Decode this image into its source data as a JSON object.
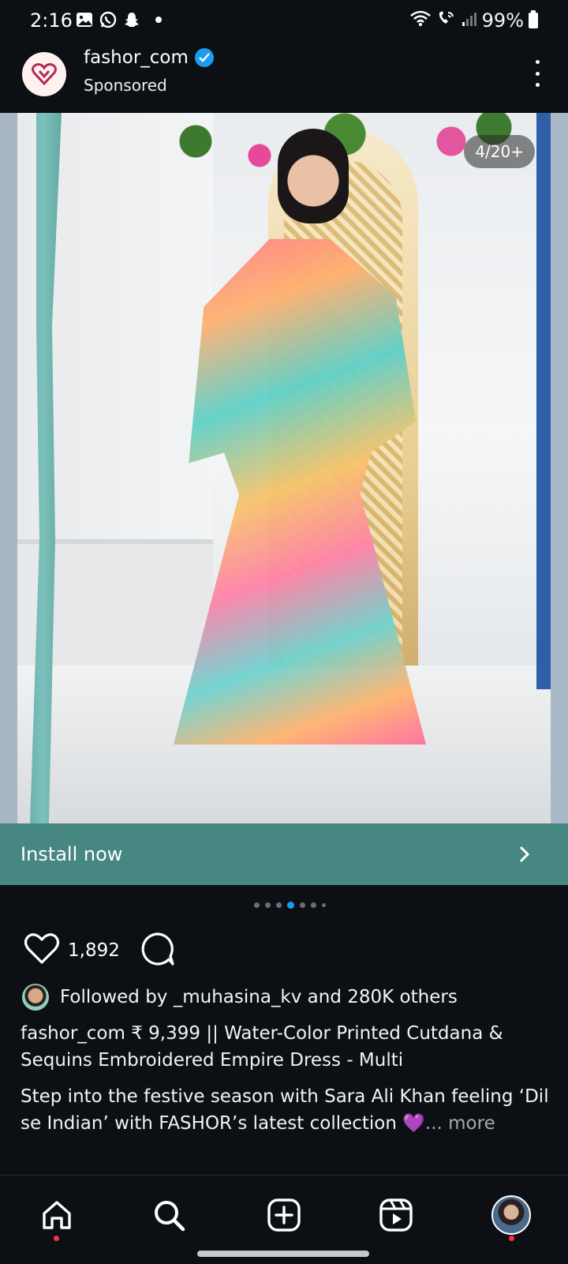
{
  "status_bar": {
    "time": "2:16",
    "battery": "99%",
    "icons": [
      "gallery-icon",
      "whatsapp-icon",
      "snapchat-icon",
      "dot-icon",
      "wifi-icon",
      "wifi-calling-icon",
      "signal-icon",
      "battery-icon"
    ]
  },
  "post": {
    "username": "fashor_com",
    "sponsored": "Sponsored",
    "image_counter": "4/20+",
    "install_label": "Install now",
    "carousel_dots": 7,
    "carousel_active": 3,
    "likes": "1,892",
    "followed_by": "Followed by _muhasina_kv and 280K others",
    "caption_user": "fashor_com",
    "caption_text": " ₹ 9,399 || Water-Color Printed Cutdana & Sequins Embroidered Empire Dress - Multi",
    "description": "Step into the festive season with Sara Ali Khan feeling ‘Dil se Indian’ with FASHOR’s latest collection 💜",
    "more": "... more"
  },
  "nav": {
    "items": [
      "home-icon",
      "search-icon",
      "create-icon",
      "reels-icon",
      "profile-avatar"
    ]
  },
  "colors": {
    "background": "#0c1014",
    "install_bar": "#468781",
    "verified": "#1d9bf0",
    "notification_dot": "#ff3040"
  }
}
